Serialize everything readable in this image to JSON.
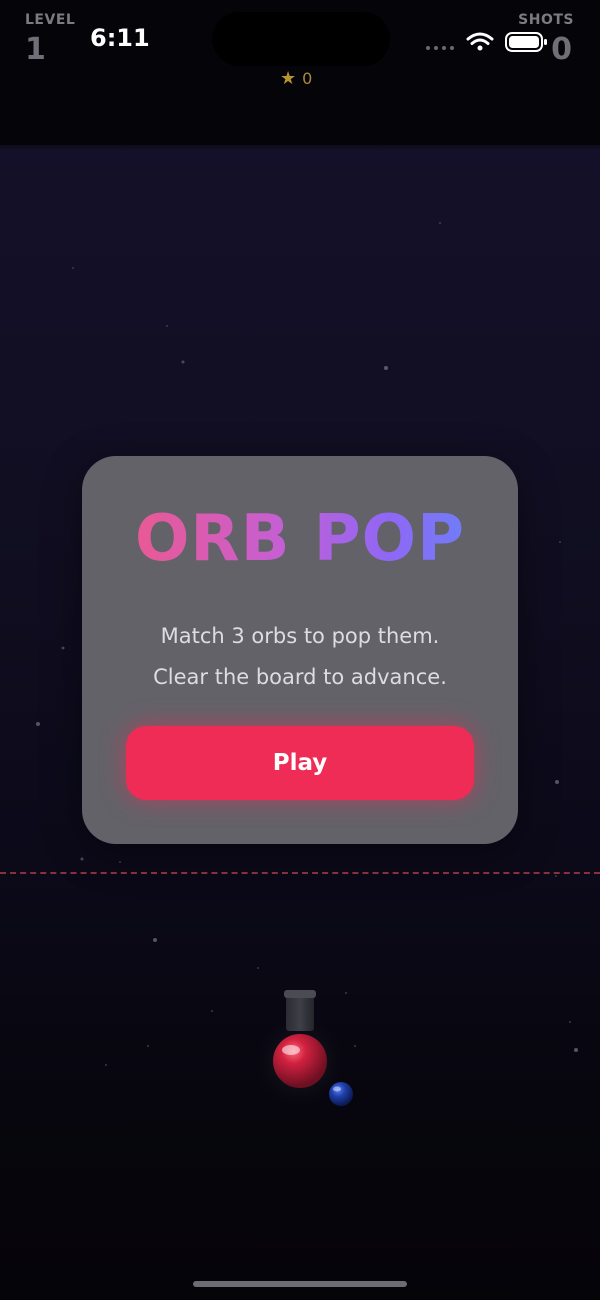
{
  "status_bar": {
    "time": "6:11",
    "signal_icon": "cellular-signal-icon",
    "wifi_icon": "wifi-icon",
    "battery_icon": "battery-icon"
  },
  "hud": {
    "level_label": "LEVEL",
    "level_value": "1",
    "shots_label": "SHOTS",
    "shots_value": "0",
    "stars_icon": "star-icon",
    "stars_value": "0"
  },
  "start_dialog": {
    "title": "ORB POP",
    "line1": "Match 3 orbs to pop them.",
    "line2": "Clear the board to advance.",
    "play_label": "Play"
  },
  "launcher": {
    "current_orb_color": "#d0213f",
    "next_orb_color": "#1f3fa8"
  },
  "colors": {
    "accent": "#ee2c55",
    "title_gradient": [
      "#f7577c",
      "#9067f5",
      "#5a8cf9"
    ],
    "danger_line": "#8a2f3c",
    "star": "#b8942f"
  }
}
